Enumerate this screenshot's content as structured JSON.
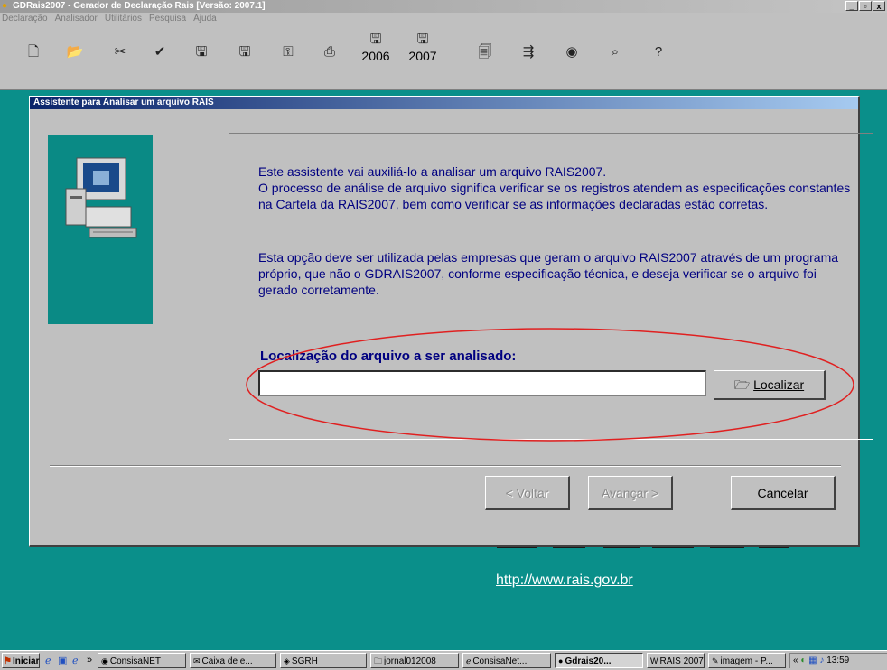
{
  "window": {
    "title": "GDRais2007 - Gerador de Declaração Rais [Versão: 2007.1]",
    "controls": {
      "minimize": "_",
      "maximize": "▫",
      "close": "x"
    }
  },
  "menu": [
    "Declaração",
    "Analisador",
    "Utilitários",
    "Pesquisa",
    "Ajuda"
  ],
  "toolbar": {
    "year_2006": "2006",
    "year_2007": "2007"
  },
  "dialog": {
    "title": "Assistente para Analisar um arquivo RAIS",
    "paragraph1": "Este assistente vai auxiliá-lo a analisar um arquivo RAIS2007.\nO processo de análise de arquivo significa verificar se os registros atendem as especificações constantes na Cartela da RAIS2007, bem como verificar se as informações declaradas estão corretas.",
    "paragraph2": "Esta opção deve ser utilizada pelas empresas que geram o arquivo RAIS2007 através de um programa próprio, que não o GDRAIS2007, conforme especificação técnica, e deseja verificar se o arquivo foi gerado corretamente.",
    "file_label": "Localização do arquivo a ser analisado:",
    "file_value": "",
    "localizar_label": "Localizar",
    "back_label": "< Voltar",
    "next_label": "Avançar >",
    "cancel_label": "Cancelar"
  },
  "background": {
    "url": "http://www.rais.gov.br"
  },
  "taskbar": {
    "start_label": "Iniciar",
    "chevron": "»",
    "tasks": [
      "ConsisaNET",
      "Caixa de e...",
      "SGRH",
      "jornal012008",
      "ConsisaNet...",
      "Gdrais20...",
      "RAIS 2007...",
      "imagem - P..."
    ],
    "tray_chevron": "«",
    "clock": "13:59"
  },
  "colors": {
    "desktop": "#0a8f8a",
    "dialog_title_start": "#0a246a",
    "dialog_text": "#000080",
    "highlight_ellipse": "#e02020"
  }
}
